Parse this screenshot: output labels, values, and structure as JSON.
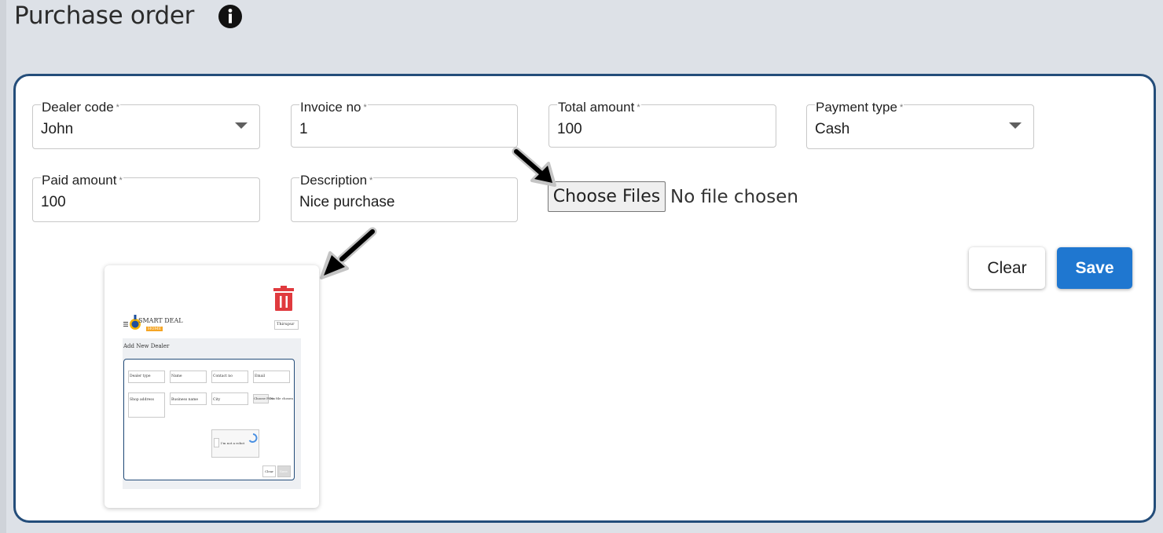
{
  "page": {
    "title": "Purchase order"
  },
  "form": {
    "dealer_code": {
      "label": "Dealer code",
      "required_mark": "*",
      "value": "John"
    },
    "invoice_no": {
      "label": "Invoice no",
      "required_mark": "*",
      "value": "1"
    },
    "total_amount": {
      "label": "Total amount",
      "required_mark": "*",
      "value": "100"
    },
    "payment_type": {
      "label": "Payment type",
      "required_mark": "*",
      "value": "Cash"
    },
    "paid_amount": {
      "label": "Paid amount",
      "required_mark": "*",
      "value": "100"
    },
    "description": {
      "label": "Description",
      "required_mark": "*",
      "value": "Nice purchase"
    },
    "file": {
      "button_label": "Choose Files",
      "status": "No file chosen"
    }
  },
  "actions": {
    "clear_label": "Clear",
    "save_label": "Save"
  },
  "preview": {
    "brand": "SMART DEAL",
    "tag": "HOME",
    "search": "Thirupur",
    "heading": "Add New Dealer",
    "fields": [
      "Dealer type",
      "Name",
      "Contact no",
      "Email",
      "Shop address",
      "Business name",
      "City"
    ],
    "checkbox_label": "I'm not a robot",
    "file_button": "Choose Files",
    "file_status": "No file chosen",
    "clear": "Clear",
    "save": "Save"
  },
  "colors": {
    "accent": "#1f77d0",
    "card_border": "#244d7a",
    "delete": "#e03a3e",
    "background": "#dde1e7"
  },
  "icons": {
    "info": "info-icon",
    "delete": "trash-icon",
    "dropdown": "chevron-down-icon"
  }
}
